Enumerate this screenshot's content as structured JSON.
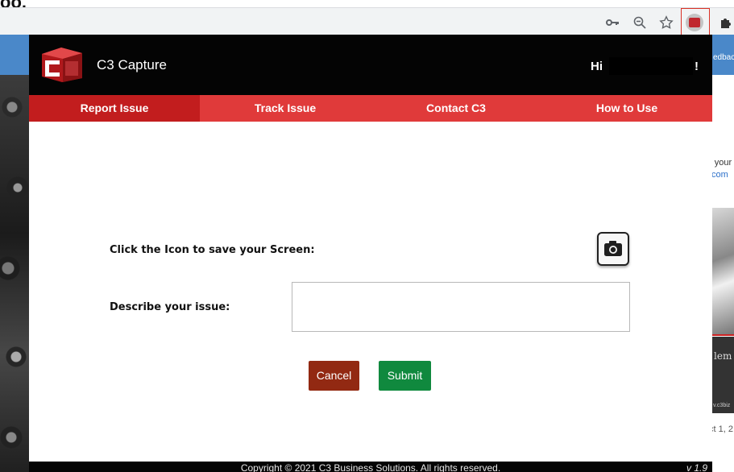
{
  "browser": {
    "top_cut_text": "oo.",
    "icons": [
      "key-icon",
      "zoom-icon",
      "star-icon",
      "extension-c3-icon",
      "puzzle-icon"
    ]
  },
  "background_page": {
    "top_text": "edbac",
    "right_text_1": "r your",
    "right_text_2": ".com",
    "right_text_3": "lem",
    "right_text_4": "v.c3biz",
    "right_text_5": "ct 1, 2"
  },
  "popup": {
    "app_title": "C3 Capture",
    "greeting": "Hi",
    "greeting_end": "!",
    "nav": [
      {
        "label": "Report Issue"
      },
      {
        "label": "Track Issue"
      },
      {
        "label": "Contact C3"
      },
      {
        "label": "How to Use"
      }
    ],
    "screen_label": "Click the Icon to save your Screen:",
    "issue_label": "Describe your issue:",
    "issue_value": "",
    "cancel_label": "Cancel",
    "submit_label": "Submit",
    "footer": "Copyright © 2021 C3 Business Solutions. All rights reserved.",
    "version": "v 1.9"
  },
  "colors": {
    "header_bg": "#040404",
    "nav_bg": "#e03a3a",
    "nav_active_bg": "#c21d1e",
    "cancel_bg": "#922912",
    "submit_bg": "#10893e"
  }
}
